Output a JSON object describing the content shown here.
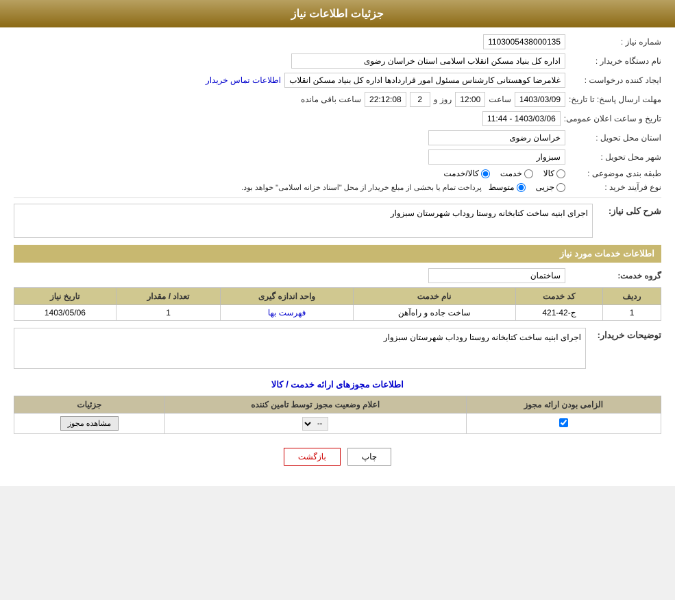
{
  "header": {
    "title": "جزئیات اطلاعات نیاز"
  },
  "need_info": {
    "number_label": "شماره نیاز :",
    "number_value": "1103005438000135",
    "buyer_org_label": "نام دستگاه خریدار :",
    "buyer_org_value": "اداره کل بنیاد مسکن انقلاب اسلامی استان خراسان رضوی",
    "requester_label": "ایجاد کننده درخواست :",
    "requester_value": "غلامرضا کوهستانی کارشناس مسئول امور قراردادها اداره کل بنیاد مسکن انقلاب",
    "contact_link": "اطلاعات تماس خریدار",
    "reply_deadline_label": "مهلت ارسال پاسخ: تا تاریخ:",
    "reply_date": "1403/03/09",
    "reply_time_label": "ساعت",
    "reply_time": "12:00",
    "reply_days_label": "روز و",
    "reply_days": "2",
    "reply_remaining_label": "ساعت باقی مانده",
    "reply_remaining": "22:12:08",
    "announce_label": "تاریخ و ساعت اعلان عمومی:",
    "announce_value": "1403/03/06 - 11:44",
    "province_label": "استان محل تحویل :",
    "province_value": "خراسان رضوی",
    "city_label": "شهر محل تحویل :",
    "city_value": "سبزوار",
    "category_label": "طبقه بندی موضوعی :",
    "category_options": [
      "کالا",
      "خدمت",
      "کالا/خدمت"
    ],
    "category_selected": "کالا/خدمت",
    "purchase_type_label": "نوع فرآیند خرید :",
    "purchase_options": [
      "جزیی",
      "متوسط"
    ],
    "purchase_description": "پرداخت تمام یا بخشی از مبلغ خریدار از محل \"اسناد خزانه اسلامی\" خواهد بود.",
    "general_desc_label": "شرح کلی نیاز:",
    "general_desc_value": "اجرای ابنیه ساخت کتابخانه روستا روداب شهرستان سبزوار"
  },
  "services": {
    "section_title": "اطلاعات خدمات مورد نیاز",
    "group_label": "گروه خدمت:",
    "group_value": "ساختمان",
    "table_headers": [
      "ردیف",
      "کد خدمت",
      "نام خدمت",
      "واحد اندازه گیری",
      "تعداد / مقدار",
      "تاریخ نیاز"
    ],
    "table_rows": [
      {
        "row": "1",
        "code": "ج-42-421",
        "name": "ساخت جاده و راه‌آهن",
        "unit": "فهرست بها",
        "quantity": "1",
        "date": "1403/05/06"
      }
    ]
  },
  "buyer_desc": {
    "label": "توضیحات خریدار:",
    "value": "اجرای ابنیه ساخت کتابخانه روستا روداب شهرستان سبزوار"
  },
  "permits": {
    "section_title": "اطلاعات مجوزهای ارائه خدمت / کالا",
    "table_headers": [
      "الزامی بودن ارائه مجوز",
      "اعلام وضعیت مجوز توسط تامین کننده",
      "جزئیات"
    ],
    "table_rows": [
      {
        "required": true,
        "status": "--",
        "detail_btn": "مشاهده مجوز"
      }
    ]
  },
  "buttons": {
    "print": "چاپ",
    "back": "بازگشت"
  }
}
